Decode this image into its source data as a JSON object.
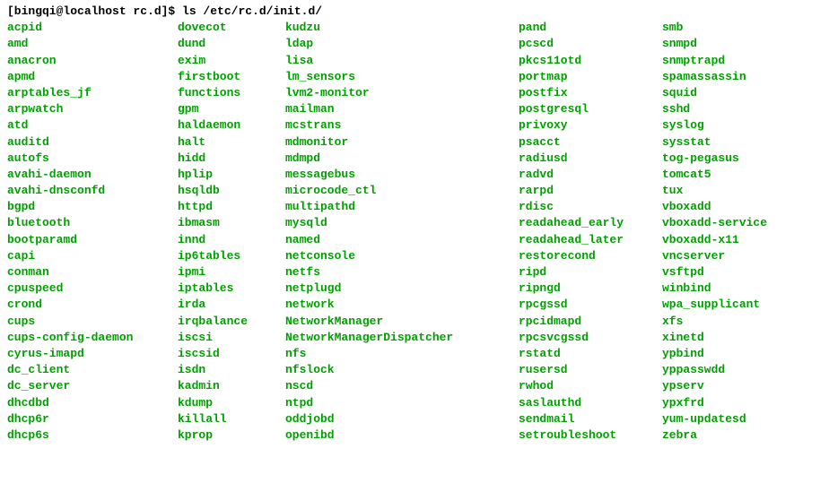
{
  "prompt": "[bingqi@localhost rc.d]$ ls /etc/rc.d/init.d/",
  "columns": [
    [
      "acpid",
      "amd",
      "anacron",
      "apmd",
      "arptables_jf",
      "arpwatch",
      "atd",
      "auditd",
      "autofs",
      "avahi-daemon",
      "avahi-dnsconfd",
      "bgpd",
      "bluetooth",
      "bootparamd",
      "capi",
      "conman",
      "cpuspeed",
      "crond",
      "cups",
      "cups-config-daemon",
      "cyrus-imapd",
      "dc_client",
      "dc_server",
      "dhcdbd",
      "dhcp6r",
      "dhcp6s"
    ],
    [
      "dovecot",
      "dund",
      "exim",
      "firstboot",
      "functions",
      "gpm",
      "haldaemon",
      "halt",
      "hidd",
      "hplip",
      "hsqldb",
      "httpd",
      "ibmasm",
      "innd",
      "ip6tables",
      "ipmi",
      "iptables",
      "irda",
      "irqbalance",
      "iscsi",
      "iscsid",
      "isdn",
      "kadmin",
      "kdump",
      "killall",
      "kprop"
    ],
    [
      "kudzu",
      "ldap",
      "lisa",
      "lm_sensors",
      "lvm2-monitor",
      "mailman",
      "mcstrans",
      "mdmonitor",
      "mdmpd",
      "messagebus",
      "microcode_ctl",
      "multipathd",
      "mysqld",
      "named",
      "netconsole",
      "netfs",
      "netplugd",
      "network",
      "NetworkManager",
      "NetworkManagerDispatcher",
      "nfs",
      "nfslock",
      "nscd",
      "ntpd",
      "oddjobd",
      "openibd"
    ],
    [
      "pand",
      "pcscd",
      "pkcs11otd",
      "portmap",
      "postfix",
      "postgresql",
      "privoxy",
      "psacct",
      "radiusd",
      "radvd",
      "rarpd",
      "rdisc",
      "readahead_early",
      "readahead_later",
      "restorecond",
      "ripd",
      "ripngd",
      "rpcgssd",
      "rpcidmapd",
      "rpcsvcgssd",
      "rstatd",
      "rusersd",
      "rwhod",
      "saslauthd",
      "sendmail",
      "setroubleshoot"
    ],
    [
      "smb",
      "snmpd",
      "snmptrapd",
      "spamassassin",
      "squid",
      "sshd",
      "syslog",
      "sysstat",
      "tog-pegasus",
      "tomcat5",
      "tux",
      "vboxadd",
      "vboxadd-service",
      "vboxadd-x11",
      "vncserver",
      "vsftpd",
      "winbind",
      "wpa_supplicant",
      "xfs",
      "xinetd",
      "ypbind",
      "yppasswdd",
      "ypserv",
      "ypxfrd",
      "yum-updatesd",
      "zebra"
    ]
  ]
}
